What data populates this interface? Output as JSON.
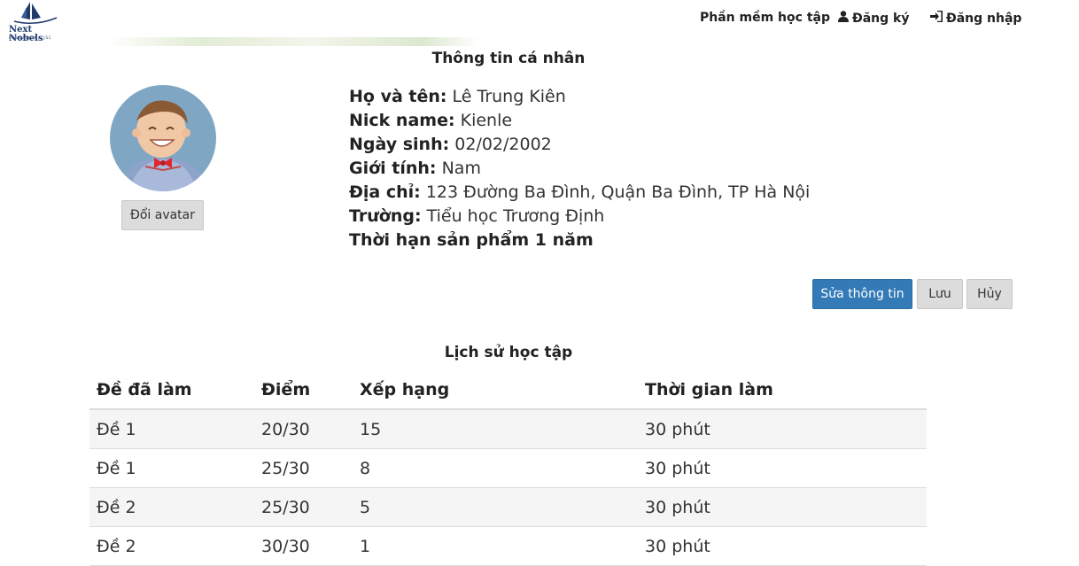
{
  "header": {
    "logo_text": "Next Nobels",
    "logo_sub": "EDUCATION., JSC",
    "nav": {
      "software": "Phần mềm học tập",
      "register": "Đăng ký",
      "login": "Đăng nhập"
    },
    "icons": {
      "register": "user-icon",
      "login": "sign-in-icon"
    }
  },
  "profile": {
    "title": "Thông tin cá nhân",
    "change_avatar": "Đổi avatar",
    "fields": [
      {
        "label": "Họ và tên:",
        "value": "Lê Trung Kiên"
      },
      {
        "label": "Nick name:",
        "value": "Kienle"
      },
      {
        "label": "Ngày sinh:",
        "value": "02/02/2002"
      },
      {
        "label": "Giới tính:",
        "value": "Nam"
      },
      {
        "label": "Địa chỉ:",
        "value": "123 Đường Ba Đình, Quận Ba Đình, TP Hà Nội"
      },
      {
        "label": "Trường:",
        "value": "Tiểu học Trương Định"
      },
      {
        "label": "Thời hạn sản phẩm 1 năm",
        "value": ""
      }
    ],
    "buttons": {
      "edit": "Sửa thông tin",
      "save": "Lưu",
      "cancel": "Hủy"
    }
  },
  "history": {
    "title": "Lịch sử học tập",
    "columns": [
      "Đề đã làm",
      "Điểm",
      "Xếp hạng",
      "Thời gian làm"
    ],
    "rows": [
      [
        "Đề 1",
        "20/30",
        "15",
        "30 phút"
      ],
      [
        "Đề 1",
        "25/30",
        "8",
        "30 phút"
      ],
      [
        "Đề 2",
        "25/30",
        "5",
        "30 phút"
      ],
      [
        "Đề 2",
        "30/30",
        "1",
        "30 phút"
      ]
    ]
  },
  "colors": {
    "primary": "#337ab7",
    "button_gray": "#dcdcdc",
    "logo": "#1f3a6b"
  }
}
